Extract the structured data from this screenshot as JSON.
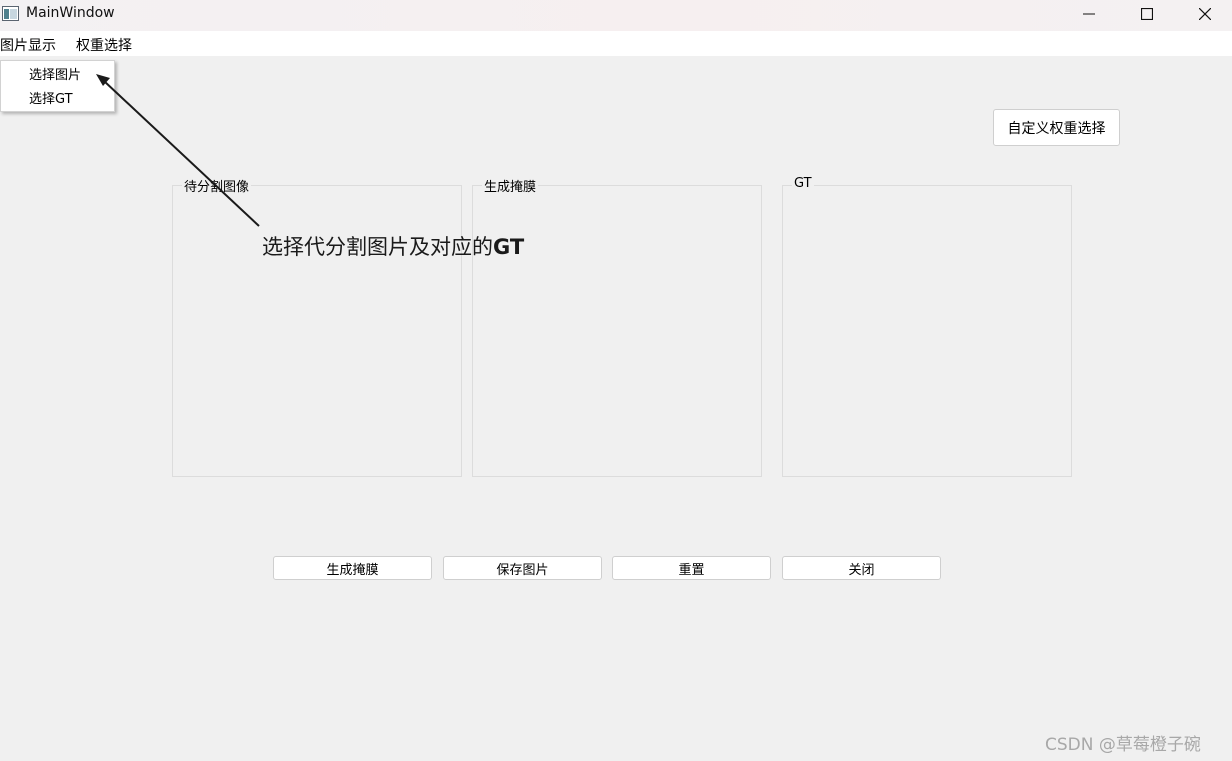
{
  "window": {
    "title": "MainWindow",
    "controls": {
      "minimize_icon": "minimize-icon",
      "maximize_icon": "maximize-icon",
      "close_icon": "close-icon"
    }
  },
  "menubar": {
    "items": [
      {
        "label": "图片显示"
      },
      {
        "label": "权重选择"
      }
    ]
  },
  "dropdown": {
    "items": [
      {
        "label": "选择图片"
      },
      {
        "label": "选择GT"
      }
    ]
  },
  "weight_button": {
    "label": "自定义权重选择"
  },
  "panels": [
    {
      "title": "待分割图像"
    },
    {
      "title": "生成掩膜"
    },
    {
      "title": "GT"
    }
  ],
  "annotation": {
    "text": "选择代分割图片及对应的",
    "bold_text": "GT"
  },
  "actions": [
    {
      "label": "生成掩膜"
    },
    {
      "label": "保存图片"
    },
    {
      "label": "重置"
    },
    {
      "label": "关闭"
    }
  ],
  "watermark": {
    "text": "CSDN @草莓橙子碗"
  },
  "colors": {
    "background": "#f0f0f0",
    "menubar": "#ffffff",
    "border": "#dcdcdc",
    "arrow": "#1a1a1a"
  }
}
